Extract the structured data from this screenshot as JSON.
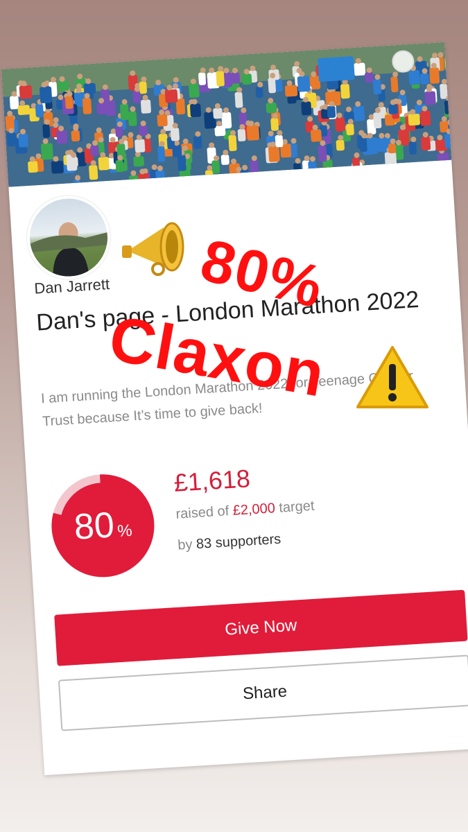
{
  "fundraiser": {
    "person_name": "Dan Jarrett",
    "page_title": "Dan's page - London Marathon 2022",
    "description": "I am running the London Marathon 2022 for Teenage Cancer Trust because It’s time to give back!",
    "percent": "80",
    "percent_symbol": "%",
    "progress_fraction": 0.8,
    "raised_amount": "£1,618",
    "raised_prefix": "raised of",
    "target_amount": "£2,000",
    "target_suffix": "target",
    "supporters_prefix": "by",
    "supporters_count": "83 supporters",
    "give_label": "Give Now",
    "share_label": "Share"
  },
  "overlay": {
    "line1": "80%",
    "line2": "Claxon"
  },
  "colors": {
    "brand_red": "#e01c3a",
    "overlay_red": "#ff1010",
    "text_gray": "#8a8a8a"
  },
  "icons": {
    "megaphone": "megaphone-icon",
    "warning": "warning-icon"
  }
}
